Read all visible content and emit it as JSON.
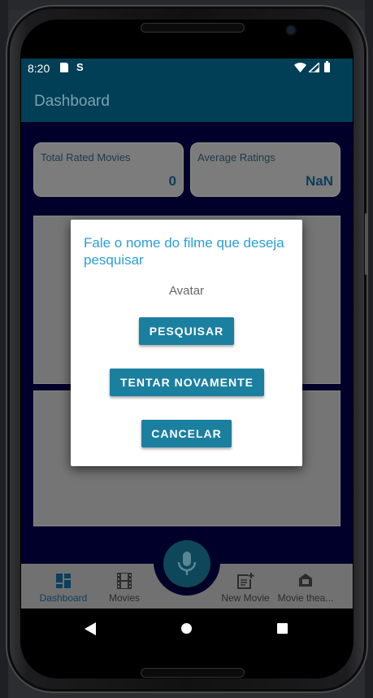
{
  "status": {
    "time": "8:20",
    "s_icon": "S"
  },
  "appbar": {
    "title": "Dashboard"
  },
  "stats": [
    {
      "label": "Total Rated Movies",
      "value": "0"
    },
    {
      "label": "Average Ratings",
      "value": "NaN"
    }
  ],
  "dialog": {
    "title": "Fale o nome do filme que deseja pesquisar",
    "recognized_text": "Avatar",
    "buttons": {
      "search": "PESQUISAR",
      "retry": "TENTAR NOVAMENTE",
      "cancel": "CANCELAR"
    }
  },
  "bottom_nav": [
    {
      "label": "Dashboard",
      "icon": "dashboard-icon",
      "active": true
    },
    {
      "label": "Movies",
      "icon": "film-icon",
      "active": false
    },
    {
      "label": "New Movie",
      "icon": "post-add-icon",
      "active": false
    },
    {
      "label": "Movie thea...",
      "icon": "theater-icon",
      "active": false
    }
  ],
  "fab": {
    "icon": "mic-icon"
  },
  "colors": {
    "appbar": "#003f55",
    "accent": "#1b7fa0",
    "dialog_title": "#2a9fd6",
    "background": "#00002a"
  }
}
